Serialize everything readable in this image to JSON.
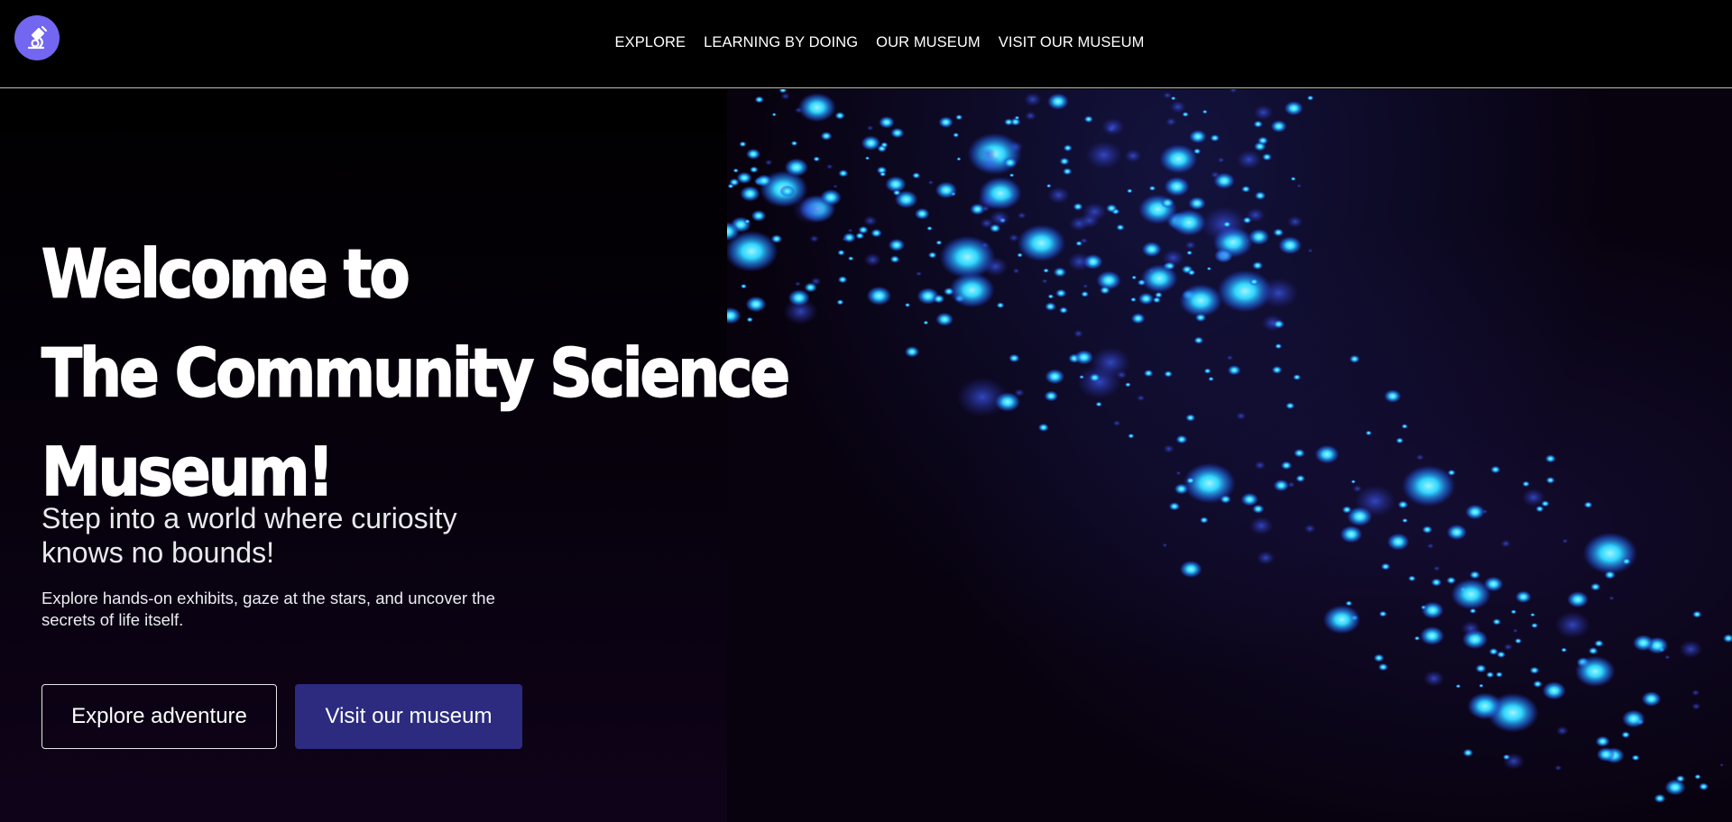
{
  "header": {
    "logo_icon": "microscope-icon",
    "nav": [
      {
        "label": "EXPLORE"
      },
      {
        "label": "LEARNING BY DOING"
      },
      {
        "label": "OUR MUSEUM"
      },
      {
        "label": "VISIT OUR MUSEUM"
      }
    ]
  },
  "hero": {
    "title_lines": [
      "Welcome to",
      "The Community Science",
      "Museum!"
    ],
    "subtitle": "Step into a world where curiosity knows no bounds!",
    "description": "Explore hands-on exhibits, gaze at the stars, and uncover the secrets of life itself.",
    "buttons": {
      "explore": "Explore adventure",
      "visit": "Visit our museum"
    },
    "visual_icon": "glowing-particles-image"
  },
  "colors": {
    "logo_bg": "#7366f0",
    "visit_button_bg": "#2c2b7f",
    "particle": "#2fd6ff"
  }
}
